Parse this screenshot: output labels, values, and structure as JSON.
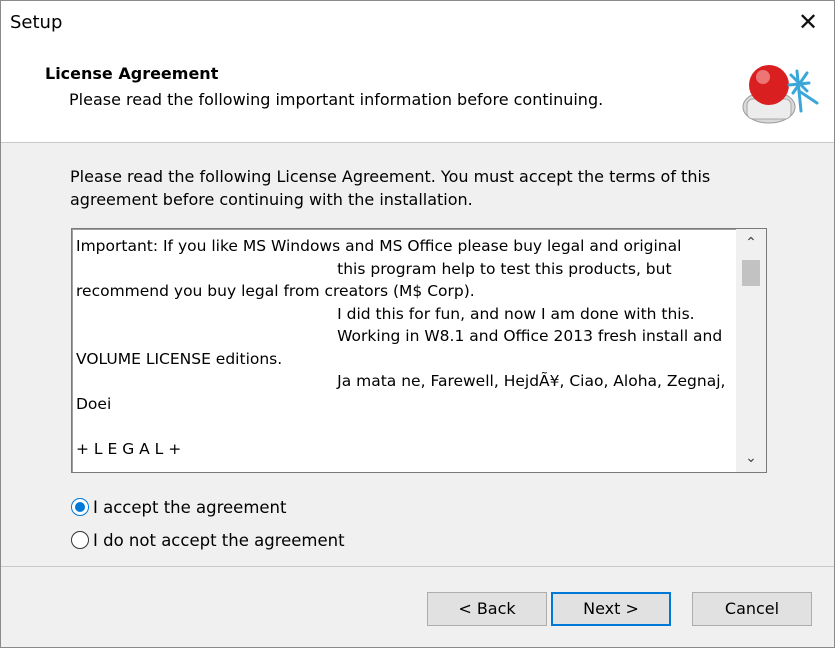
{
  "window": {
    "title": "Setup",
    "close_label": "✕"
  },
  "header": {
    "title": "License Agreement",
    "subtitle": "Please read the following important information before continuing."
  },
  "intro_text": "Please read the following License Agreement. You must accept the terms of this agreement before continuing with the installation.",
  "license": {
    "text": "Important: If you like MS Windows and MS Office please buy legal and original\n                                                     this program help to test this products, but\nrecommend you buy legal from creators (M$ Corp).\n                                                     I did this for fun, and now I am done with this.\n                                                     Working in W8.1 and Office 2013 fresh install and\nVOLUME LICENSE editions.\n                                                     Ja mata ne, Farewell, HejdÃ¥, Ciao, Aloha, Zegnaj,\nDoei\n\n+ L E G A L +"
  },
  "options": [
    {
      "label": "I accept the agreement",
      "checked": true
    },
    {
      "label": "I do not accept the agreement",
      "checked": false
    }
  ],
  "buttons": {
    "back": "< Back",
    "next": "Next >",
    "cancel": "Cancel"
  },
  "colors": {
    "accent": "#0078d7",
    "dialog_bg": "#f0f0f0"
  }
}
